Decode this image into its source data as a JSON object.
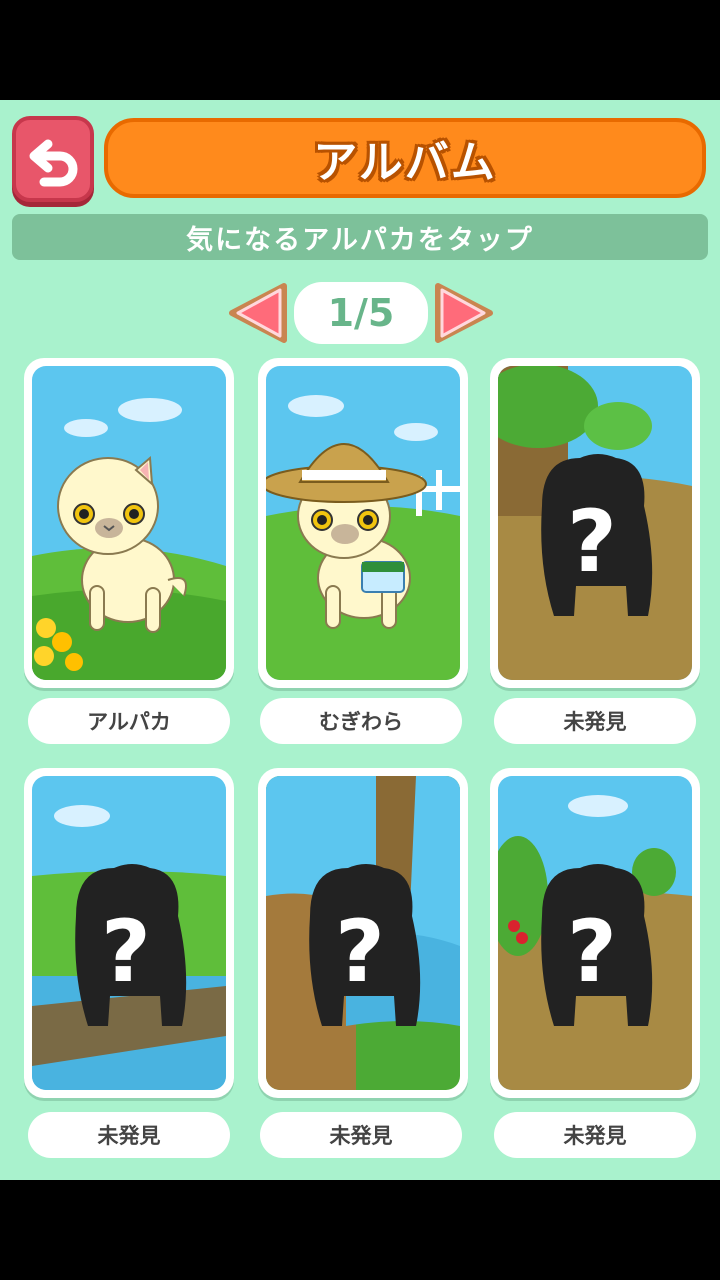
{
  "header": {
    "back_icon": "u-turn-arrow-icon",
    "title": "アルバム",
    "subtitle": "気になるアルパカをタップ"
  },
  "pager": {
    "page": "1/5",
    "prev_icon": "triangle-left-icon",
    "next_icon": "triangle-right-icon"
  },
  "cards": [
    {
      "label": "アルパカ",
      "discovered": true
    },
    {
      "label": "むぎわら",
      "discovered": true
    },
    {
      "label": "未発見",
      "discovered": false
    },
    {
      "label": "未発見",
      "discovered": false
    },
    {
      "label": "未発見",
      "discovered": false
    },
    {
      "label": "未発見",
      "discovered": false
    }
  ],
  "colors": {
    "background": "#a9f2cd",
    "accent_orange": "#ff8a1c",
    "back_button": "#e8566a",
    "subtitle_bar": "#7dc19a",
    "page_text": "#68b58a"
  }
}
